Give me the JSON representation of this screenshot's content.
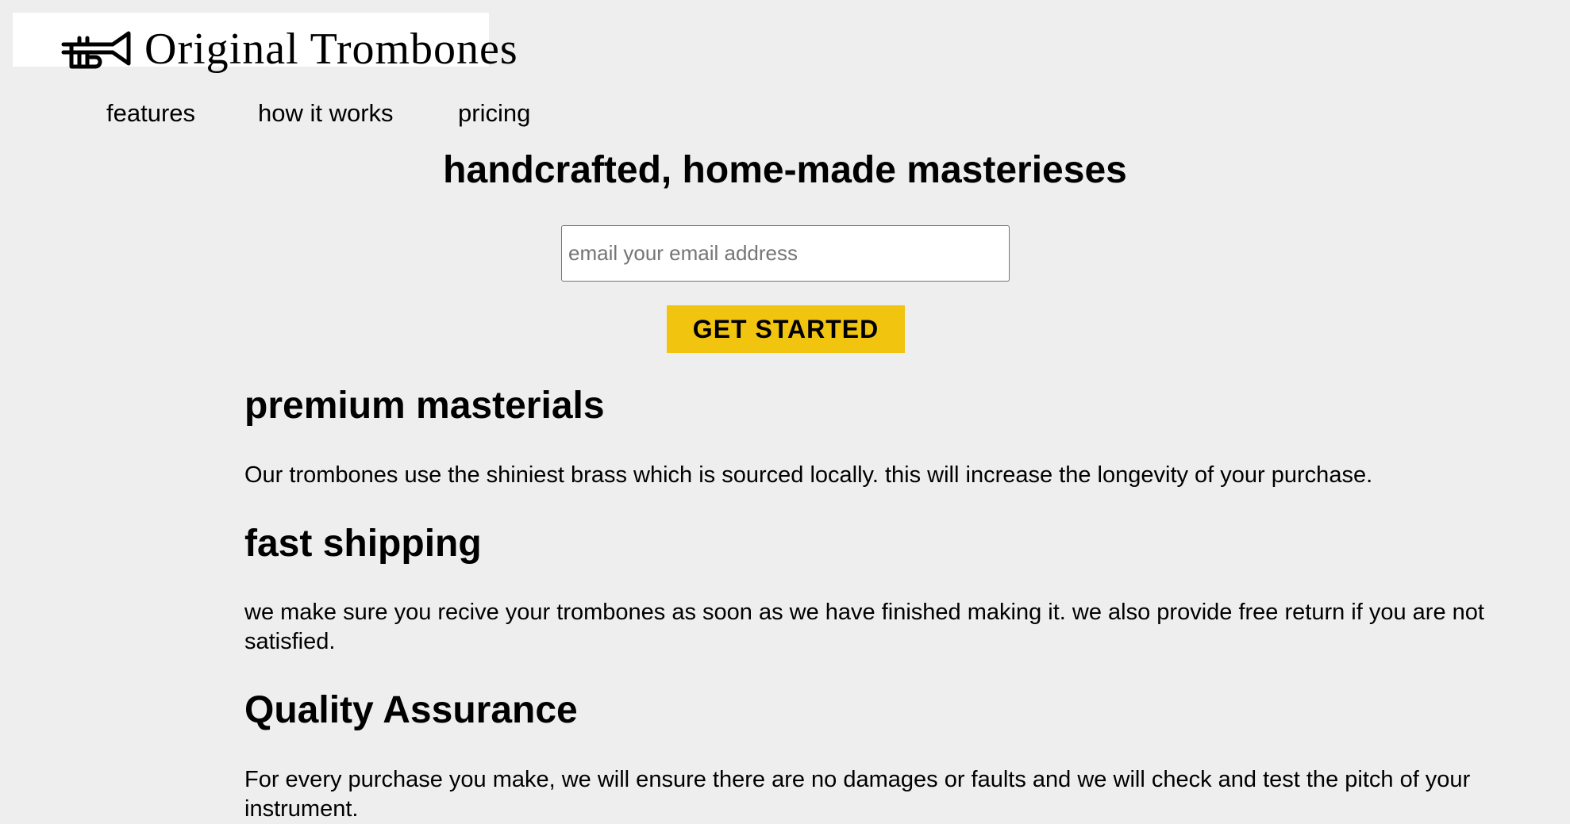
{
  "brand": {
    "name": "Original Trombones",
    "icon": "trombone-icon"
  },
  "nav": {
    "items": [
      {
        "label": "features"
      },
      {
        "label": "how it works"
      },
      {
        "label": "pricing"
      }
    ]
  },
  "hero": {
    "title": "handcrafted, home-made masterieses",
    "email_placeholder": "email your email address",
    "email_value": "",
    "cta_label": "GET STARTED",
    "cta_color": "#f1c40f"
  },
  "features": [
    {
      "title": "premium masterials",
      "body": "Our trombones use the shiniest brass which is sourced locally. this will increase the longevity of your purchase."
    },
    {
      "title": "fast shipping",
      "body": "we make sure you recive your trombones as soon as we have finished making it. we also provide free return if you are not satisfied."
    },
    {
      "title": "Quality Assurance",
      "body": "For every purchase you make, we will ensure there are no damages or faults and we will check and test the pitch of your instrument."
    }
  ]
}
